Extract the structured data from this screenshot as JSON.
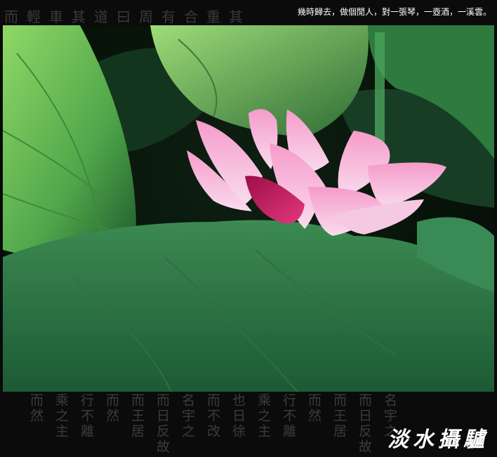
{
  "header": {
    "caption": "幾時歸去，做個閒人，對一張琴，一壺酒，一溪雲。",
    "background_glyphs": "而輕車其道曰周有合重其"
  },
  "footer": {
    "calligraphy_columns": [
      "而然",
      "乘之主",
      "行不離",
      "而然",
      "而王居",
      "而日反故",
      "名宇之",
      "而不改",
      "也日徐",
      "乘之主",
      "行不離",
      "而然",
      "而王居",
      "而日反故",
      "名宇之"
    ],
    "signature": "淡水攝驢"
  },
  "photo": {
    "subject": "pink lotus flower among green leaves",
    "colors": {
      "leaf_light": "#7fcf5a",
      "leaf_mid": "#3f8f4a",
      "leaf_dark": "#1f5a2e",
      "petal_light": "#f7d3ea",
      "petal_pink": "#ef7fb9",
      "petal_deep": "#c0145a"
    }
  }
}
